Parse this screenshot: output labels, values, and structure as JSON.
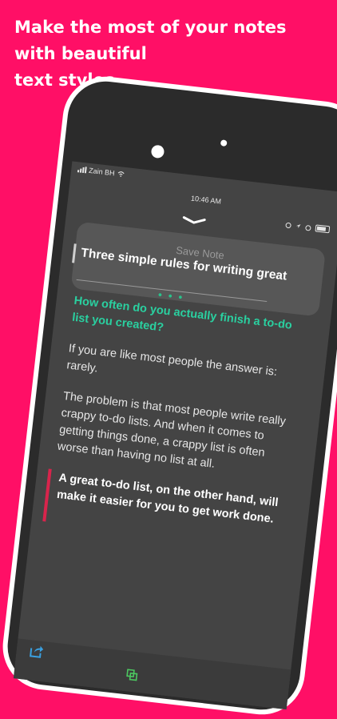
{
  "headline": {
    "line1": "Make the most of your notes",
    "line2": "with beautiful",
    "line3": "text styles."
  },
  "status_bar": {
    "carrier": "Zain BH",
    "time": "10:46 AM"
  },
  "note": {
    "save_label": "Save Note",
    "title": "Three simple rules for writing great",
    "divider_dots": "• • •",
    "heading": "How often do you actually finish a to-do list you created?",
    "paragraph1": "If you are like most people the answer is: rarely.",
    "paragraph2": "The problem is that most people write really crappy to-do lists. And when it comes to getting things done, a crappy list is often worse than having no list at all.",
    "quote": "A great to-do list, on the other hand, will make it easier for you to get work done."
  },
  "colors": {
    "background": "#ff0f66",
    "accent_green": "#2ad0a0",
    "quote_bar": "#d8244c",
    "share_icon": "#3aa0e0",
    "duplicate_icon": "#4cc860"
  }
}
